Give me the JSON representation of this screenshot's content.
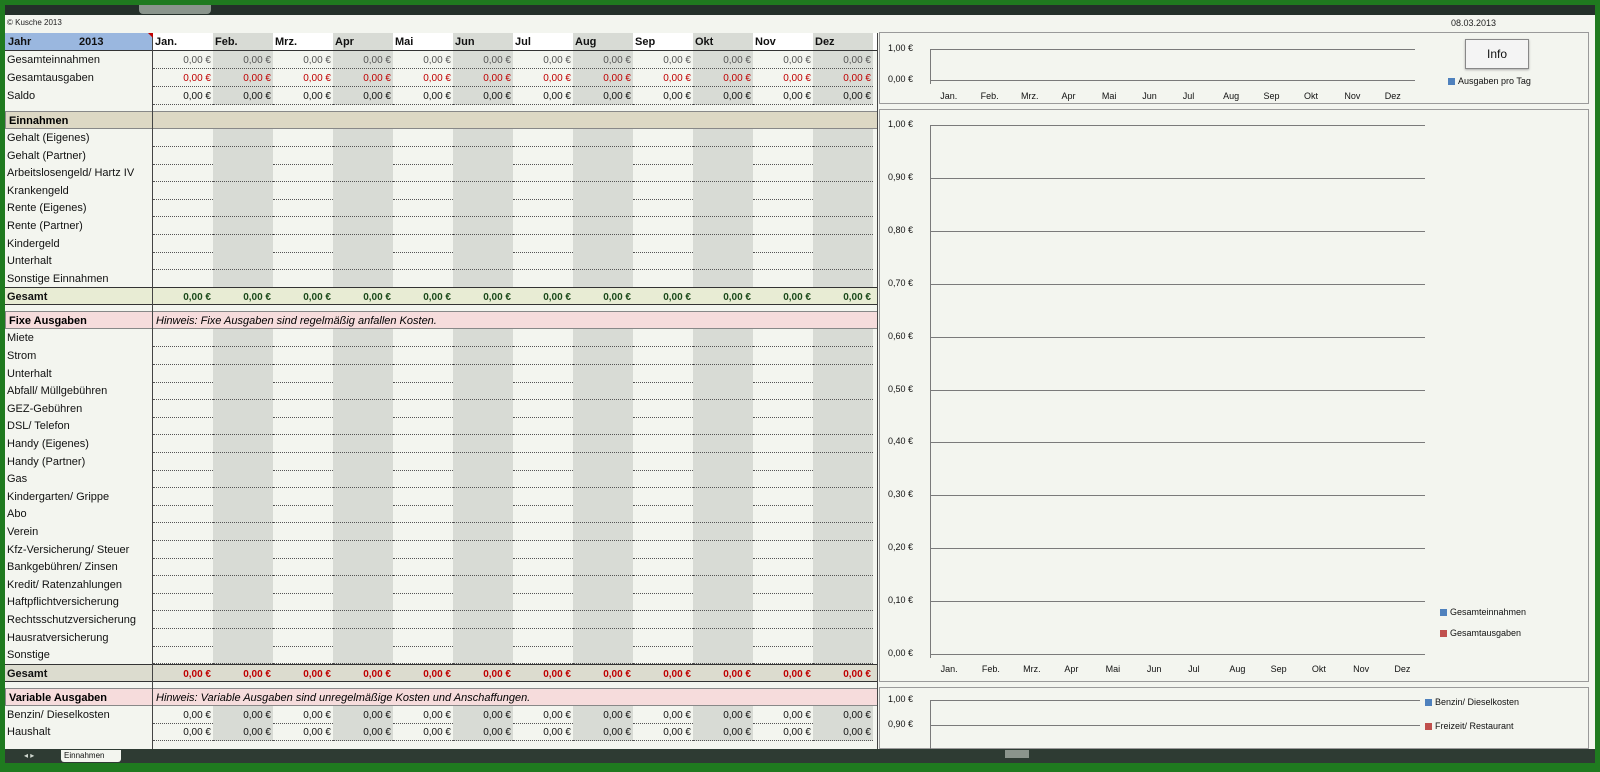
{
  "copyright": "© Kusche 2013",
  "date": "08.03.2013",
  "info_label": "Info",
  "year_label": "Jahr",
  "year": "2013",
  "months": [
    "Jan.",
    "Feb.",
    "Mrz.",
    "Apr",
    "Mai",
    "Jun",
    "Jul",
    "Aug",
    "Sep",
    "Okt",
    "Nov",
    "Dez"
  ],
  "summary_rows": [
    {
      "label": "Gesamteinnahmen",
      "values": [
        "0,00 €",
        "0,00 €",
        "0,00 €",
        "0,00 €",
        "0,00 €",
        "0,00 €",
        "0,00 €",
        "0,00 €",
        "0,00 €",
        "0,00 €",
        "0,00 €",
        "0,00 €"
      ],
      "color": "normal"
    },
    {
      "label": "Gesamtausgaben",
      "values": [
        "0,00 €",
        "0,00 €",
        "0,00 €",
        "0,00 €",
        "0,00 €",
        "0,00 €",
        "0,00 €",
        "0,00 €",
        "0,00 €",
        "0,00 €",
        "0,00 €",
        "0,00 €"
      ],
      "color": "red"
    },
    {
      "label": "Saldo",
      "values": [
        "0,00 €",
        "0,00 €",
        "0,00 €",
        "0,00 €",
        "0,00 €",
        "0,00 €",
        "0,00 €",
        "0,00 €",
        "0,00 €",
        "0,00 €",
        "0,00 €",
        "0,00 €"
      ],
      "color": "black"
    }
  ],
  "einnahmen": {
    "title": "Einnahmen",
    "items": [
      "Gehalt (Eigenes)",
      "Gehalt  (Partner)",
      "Arbeitslosengeld/ Hartz IV",
      "Krankengeld",
      "Rente (Eigenes)",
      "Rente (Partner)",
      "Kindergeld",
      "Unterhalt",
      "Sonstige Einnahmen"
    ],
    "total_label": "Gesamt",
    "totals": [
      "0,00 €",
      "0,00 €",
      "0,00 €",
      "0,00 €",
      "0,00 €",
      "0,00 €",
      "0,00 €",
      "0,00 €",
      "0,00 €",
      "0,00 €",
      "0,00 €",
      "0,00 €"
    ]
  },
  "fixe": {
    "title": "Fixe Ausgaben",
    "hint": "Hinweis: Fixe Ausgaben sind regelmäßig anfallen Kosten.",
    "items": [
      "Miete",
      "Strom",
      "Unterhalt",
      "Abfall/ Müllgebühren",
      "GEZ-Gebühren",
      "DSL/ Telefon",
      "Handy (Eigenes)",
      "Handy (Partner)",
      "Gas",
      "Kindergarten/ Grippe",
      "Abo",
      "Verein",
      "Kfz-Versicherung/ Steuer",
      "Bankgebühren/ Zinsen",
      "Kredit/ Ratenzahlungen",
      "Haftpflichtversicherung",
      "Rechtsschutzversicherung",
      "Hausratversicherung",
      "Sonstige"
    ],
    "total_label": "Gesamt",
    "totals": [
      "0,00 €",
      "0,00 €",
      "0,00 €",
      "0,00 €",
      "0,00 €",
      "0,00 €",
      "0,00 €",
      "0,00 €",
      "0,00 €",
      "0,00 €",
      "0,00 €",
      "0,00 €"
    ]
  },
  "variable": {
    "title": "Variable Ausgaben",
    "hint": "Hinweis: Variable Ausgaben sind unregelmäßige Kosten und Anschaffungen.",
    "items": [
      {
        "label": "Benzin/ Dieselkosten",
        "values": [
          "0,00 €",
          "0,00 €",
          "0,00 €",
          "0,00 €",
          "0,00 €",
          "0,00 €",
          "0,00 €",
          "0,00 €",
          "0,00 €",
          "0,00 €",
          "0,00 €",
          "0,00 €"
        ]
      },
      {
        "label": "Haushalt",
        "values": [
          "0,00 €",
          "0,00 €",
          "0,00 €",
          "0,00 €",
          "0,00 €",
          "0,00 €",
          "0,00 €",
          "0,00 €",
          "0,00 €",
          "0,00 €",
          "0,00 €",
          "0,00 €"
        ]
      }
    ]
  },
  "chart_data": [
    {
      "type": "bar",
      "categories": [
        "Jan.",
        "Feb.",
        "Mrz.",
        "Apr",
        "Mai",
        "Jun",
        "Jul",
        "Aug",
        "Sep",
        "Okt",
        "Nov",
        "Dez"
      ],
      "series": [
        {
          "name": "Ausgaben pro Tag",
          "values": [
            0,
            0,
            0,
            0,
            0,
            0,
            0,
            0,
            0,
            0,
            0,
            0
          ],
          "color": "#4f81bd"
        }
      ],
      "yticks": [
        "1,00 €",
        "0,00 €"
      ],
      "ylim": [
        0,
        1
      ],
      "legend": "right"
    },
    {
      "type": "bar",
      "categories": [
        "Jan.",
        "Feb.",
        "Mrz.",
        "Apr",
        "Mai",
        "Jun",
        "Jul",
        "Aug",
        "Sep",
        "Okt",
        "Nov",
        "Dez"
      ],
      "series": [
        {
          "name": "Gesamteinnahmen",
          "values": [
            0,
            0,
            0,
            0,
            0,
            0,
            0,
            0,
            0,
            0,
            0,
            0
          ],
          "color": "#4f81bd"
        },
        {
          "name": "Gesamtausgaben",
          "values": [
            0,
            0,
            0,
            0,
            0,
            0,
            0,
            0,
            0,
            0,
            0,
            0
          ],
          "color": "#c0504d"
        }
      ],
      "yticks": [
        "1,00 €",
        "0,90 €",
        "0,80 €",
        "0,70 €",
        "0,60 €",
        "0,50 €",
        "0,40 €",
        "0,30 €",
        "0,20 €",
        "0,10 €",
        "0,00 €"
      ],
      "ylim": [
        0,
        1
      ],
      "legend": "right"
    },
    {
      "type": "bar",
      "categories": [],
      "series": [
        {
          "name": "Benzin/ Dieselkosten",
          "values": [],
          "color": "#4f81bd"
        },
        {
          "name": "Freizeit/ Restaurant",
          "values": [],
          "color": "#c0504d"
        }
      ],
      "yticks": [
        "1,00 €",
        "0,90 €"
      ],
      "ylim": [
        0,
        1
      ],
      "legend": "right"
    }
  ],
  "sheet_tabs": [
    "Einnahmen"
  ],
  "colors": {
    "header_blue": "#9ab7df",
    "section_tan": "#ddd8c4",
    "section_pink": "#f6dcdc",
    "negative_red": "#c00000",
    "total_green": "#1a4a1a"
  }
}
